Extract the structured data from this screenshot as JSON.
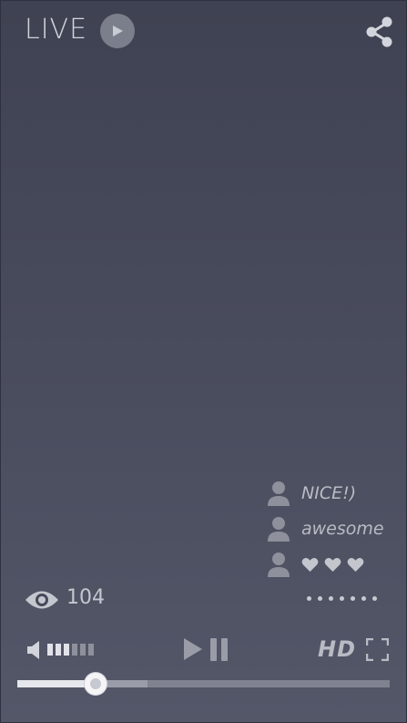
{
  "header": {
    "live_label": "LIVE",
    "live_icon": "play-circle-icon",
    "share_icon": "share-icon"
  },
  "chat": {
    "messages": [
      {
        "text": "NICE!)",
        "avatar_icon": "user-icon"
      },
      {
        "text": "awesome",
        "avatar_icon": "user-icon"
      },
      {
        "text": "",
        "hearts": 3,
        "avatar_icon": "user-icon",
        "heart_icon": "heart-icon"
      }
    ]
  },
  "stats": {
    "viewer_icon": "eye-icon",
    "viewers": "104",
    "more_icon": "dots-icon"
  },
  "controls": {
    "volume_icon": "speaker-icon",
    "volume_level": 0.5,
    "play_icon": "play-icon",
    "pause_icon": "pause-icon",
    "quality_label": "HD",
    "fullscreen_icon": "fullscreen-icon"
  },
  "progress": {
    "played": 0.21,
    "buffered": 0.35
  },
  "colors": {
    "background_top": "#3f4252",
    "background_bottom": "#535768",
    "icon": "#8e909b",
    "text": "#c9cbd3",
    "progress_played": "#e6e7ec"
  }
}
